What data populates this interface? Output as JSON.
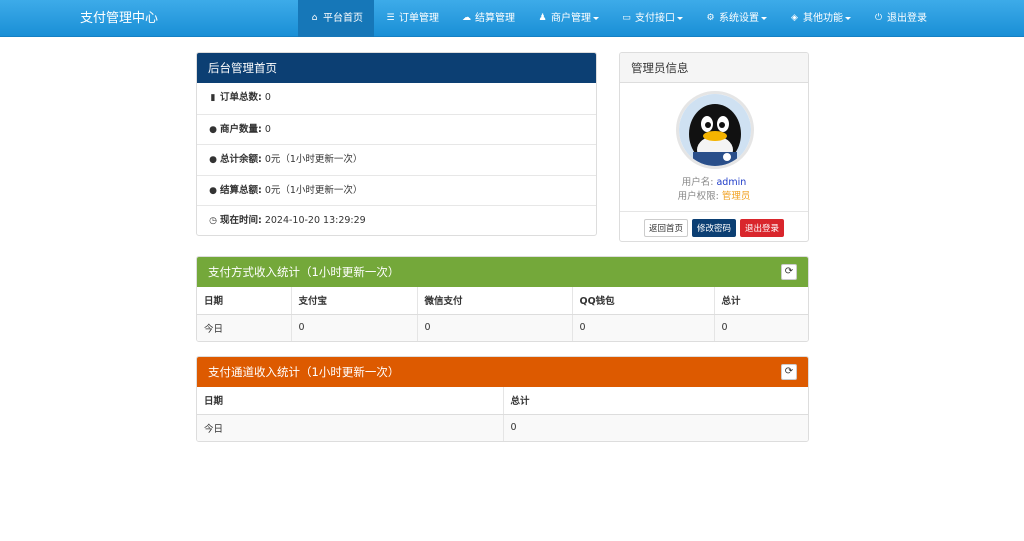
{
  "navbar": {
    "brand": "支付管理中心",
    "items": [
      {
        "icon": "home-icon",
        "glyph": "⌂",
        "label": "平台首页",
        "active": true,
        "dropdown": false
      },
      {
        "icon": "list-icon",
        "glyph": "☰",
        "label": "订单管理",
        "active": false,
        "dropdown": false
      },
      {
        "icon": "cloud-icon",
        "glyph": "☁",
        "label": "结算管理",
        "active": false,
        "dropdown": false
      },
      {
        "icon": "user-icon",
        "glyph": "♟",
        "label": "商户管理",
        "active": false,
        "dropdown": true
      },
      {
        "icon": "credit-card-icon",
        "glyph": "▭",
        "label": "支付接口",
        "active": false,
        "dropdown": true
      },
      {
        "icon": "gear-icon",
        "glyph": "⚙",
        "label": "系统设置",
        "active": false,
        "dropdown": true
      },
      {
        "icon": "cube-icon",
        "glyph": "◈",
        "label": "其他功能",
        "active": false,
        "dropdown": true
      },
      {
        "icon": "power-icon",
        "glyph": "⏻",
        "label": "退出登录",
        "active": false,
        "dropdown": false
      }
    ]
  },
  "home_panel": {
    "title": "后台管理首页",
    "rows": [
      {
        "icon": "bar-chart-icon",
        "glyph": "▮",
        "label": "订单总数:",
        "value": "0"
      },
      {
        "icon": "drop-icon",
        "glyph": "●",
        "label": "商户数量:",
        "value": "0"
      },
      {
        "icon": "drop-icon",
        "glyph": "●",
        "label": "总计余额:",
        "value": "0元（1小时更新一次）"
      },
      {
        "icon": "drop-icon",
        "glyph": "●",
        "label": "结算总额:",
        "value": "0元（1小时更新一次）"
      },
      {
        "icon": "clock-icon",
        "glyph": "◷",
        "label": "现在时间:",
        "value": "2024-10-20 13:29:29"
      }
    ]
  },
  "admin_panel": {
    "title": "管理员信息",
    "username_label": "用户名:",
    "username": "admin",
    "role_label": "用户权限:",
    "role": "管理员",
    "buttons": {
      "home": "返回首页",
      "change_password": "修改密码",
      "logout": "退出登录"
    }
  },
  "pay_panel": {
    "title": "支付方式收入统计（1小时更新一次）",
    "headers": [
      "日期",
      "支付宝",
      "微信支付",
      "QQ钱包",
      "总计"
    ],
    "rows": [
      [
        "今日",
        "0",
        "0",
        "0",
        "0"
      ]
    ]
  },
  "channel_panel": {
    "title": "支付通道收入统计（1小时更新一次）",
    "headers": [
      "日期",
      "总计"
    ],
    "rows": [
      [
        "今日",
        "0"
      ]
    ]
  },
  "colors": {
    "navbar": "#1a8fd6",
    "home_heading": "#0c3f73",
    "pay_heading": "#74a83a",
    "channel_heading": "#dd5a00"
  }
}
